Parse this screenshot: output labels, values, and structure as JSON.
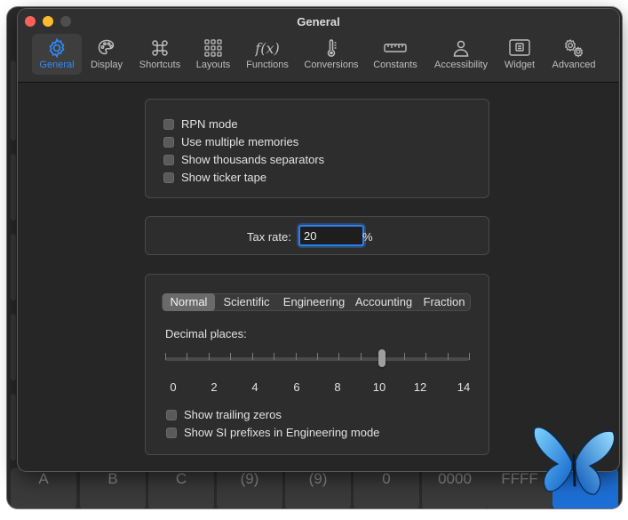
{
  "window": {
    "title": "General"
  },
  "toolbar": {
    "items": [
      {
        "label": "General",
        "icon": "gear-icon",
        "active": true
      },
      {
        "label": "Display",
        "icon": "palette-icon",
        "active": false
      },
      {
        "label": "Shortcuts",
        "icon": "command-icon",
        "active": false
      },
      {
        "label": "Layouts",
        "icon": "grid-icon",
        "active": false
      },
      {
        "label": "Functions",
        "icon": "function-icon",
        "active": false
      },
      {
        "label": "Conversions",
        "icon": "thermometer-icon",
        "active": false
      },
      {
        "label": "Constants",
        "icon": "ruler-icon",
        "active": false
      },
      {
        "label": "Accessibility",
        "icon": "person-icon",
        "active": false
      },
      {
        "label": "Widget",
        "icon": "widget-icon",
        "active": false
      },
      {
        "label": "Advanced",
        "icon": "gears-icon",
        "active": false
      }
    ]
  },
  "general": {
    "options": [
      {
        "label": "RPN mode",
        "checked": false
      },
      {
        "label": "Use multiple memories",
        "checked": false
      },
      {
        "label": "Show thousands separators",
        "checked": false
      },
      {
        "label": "Show ticker tape",
        "checked": false
      }
    ]
  },
  "tax": {
    "label": "Tax rate:",
    "value": "20",
    "unit": "%"
  },
  "format": {
    "segments": [
      "Normal",
      "Scientific",
      "Engineering",
      "Accounting",
      "Fraction"
    ],
    "selected": "Normal",
    "decimal_label": "Decimal places:",
    "slider_labels": [
      "0",
      "2",
      "4",
      "6",
      "8",
      "10",
      "12",
      "14"
    ],
    "slider_min": 0,
    "slider_max": 14,
    "slider_value": 10,
    "options": [
      {
        "label": "Show trailing zeros",
        "checked": false
      },
      {
        "label": "Show SI prefixes in Engineering mode",
        "checked": false
      }
    ]
  },
  "background_keys": [
    "A",
    "B",
    "C",
    "(9)",
    "(9)",
    "0",
    "0000",
    "FFFF",
    ""
  ],
  "colors": {
    "accent": "#2f8cff",
    "window_bg": "#262626",
    "panel_bg": "#2d2d2d"
  }
}
